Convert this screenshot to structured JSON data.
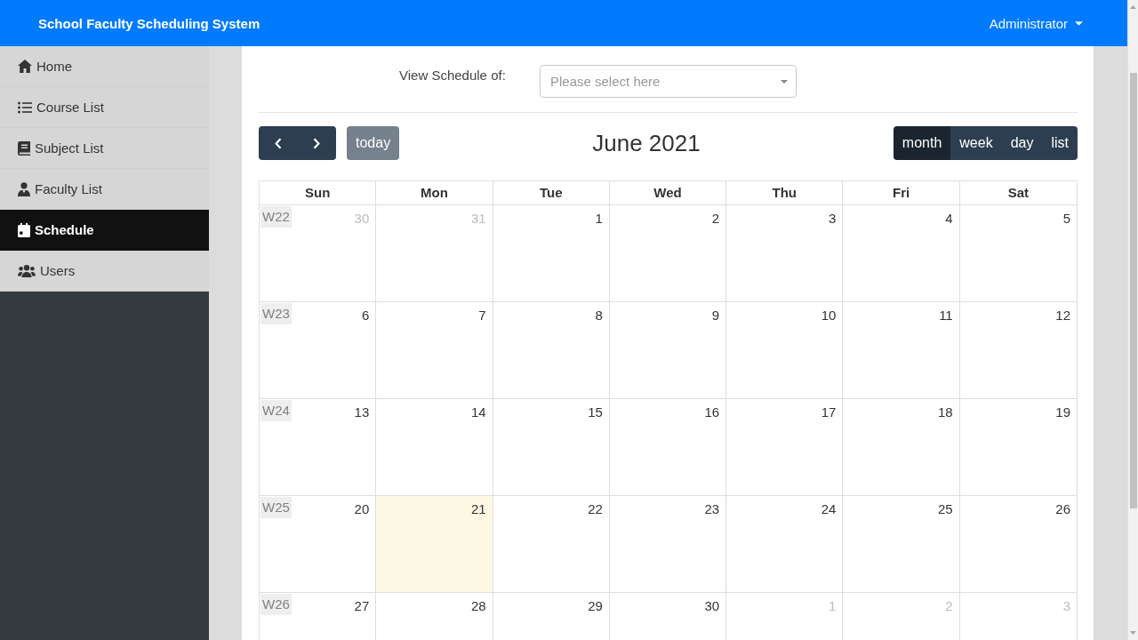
{
  "navbar": {
    "title": "School Faculty Scheduling System",
    "user_menu": "Administrator"
  },
  "sidebar": {
    "items": [
      {
        "label": "Home",
        "selected": false
      },
      {
        "label": "Course List",
        "selected": false
      },
      {
        "label": "Subject List",
        "selected": false
      },
      {
        "label": "Faculty List",
        "selected": false
      },
      {
        "label": "Schedule",
        "selected": true
      },
      {
        "label": "Users",
        "selected": false
      }
    ]
  },
  "schedule_filter": {
    "label": "View Schedule of:",
    "placeholder": "Please select here"
  },
  "calendar": {
    "today_button": {
      "label": "today",
      "disabled": true
    },
    "title": "June 2021",
    "views": [
      {
        "label": "month",
        "selected": true
      },
      {
        "label": "week",
        "selected": false
      },
      {
        "label": "day",
        "selected": false
      },
      {
        "label": "list",
        "selected": false
      }
    ],
    "weekdays": [
      "Sun",
      "Mon",
      "Tue",
      "Wed",
      "Thu",
      "Fri",
      "Sat"
    ],
    "weeks": [
      {
        "week": "W22",
        "days": [
          {
            "day": "30",
            "other_month": true,
            "today": false
          },
          {
            "day": "31",
            "other_month": true,
            "today": false
          },
          {
            "day": "1",
            "other_month": false,
            "today": false
          },
          {
            "day": "2",
            "other_month": false,
            "today": false
          },
          {
            "day": "3",
            "other_month": false,
            "today": false
          },
          {
            "day": "4",
            "other_month": false,
            "today": false
          },
          {
            "day": "5",
            "other_month": false,
            "today": false
          }
        ]
      },
      {
        "week": "W23",
        "days": [
          {
            "day": "6",
            "other_month": false,
            "today": false
          },
          {
            "day": "7",
            "other_month": false,
            "today": false
          },
          {
            "day": "8",
            "other_month": false,
            "today": false
          },
          {
            "day": "9",
            "other_month": false,
            "today": false
          },
          {
            "day": "10",
            "other_month": false,
            "today": false
          },
          {
            "day": "11",
            "other_month": false,
            "today": false
          },
          {
            "day": "12",
            "other_month": false,
            "today": false
          }
        ]
      },
      {
        "week": "W24",
        "days": [
          {
            "day": "13",
            "other_month": false,
            "today": false
          },
          {
            "day": "14",
            "other_month": false,
            "today": false
          },
          {
            "day": "15",
            "other_month": false,
            "today": false
          },
          {
            "day": "16",
            "other_month": false,
            "today": false
          },
          {
            "day": "17",
            "other_month": false,
            "today": false
          },
          {
            "day": "18",
            "other_month": false,
            "today": false
          },
          {
            "day": "19",
            "other_month": false,
            "today": false
          }
        ]
      },
      {
        "week": "W25",
        "days": [
          {
            "day": "20",
            "other_month": false,
            "today": false
          },
          {
            "day": "21",
            "other_month": false,
            "today": true
          },
          {
            "day": "22",
            "other_month": false,
            "today": false
          },
          {
            "day": "23",
            "other_month": false,
            "today": false
          },
          {
            "day": "24",
            "other_month": false,
            "today": false
          },
          {
            "day": "25",
            "other_month": false,
            "today": false
          },
          {
            "day": "26",
            "other_month": false,
            "today": false
          }
        ]
      },
      {
        "week": "W26",
        "days": [
          {
            "day": "27",
            "other_month": false,
            "today": false
          },
          {
            "day": "28",
            "other_month": false,
            "today": false
          },
          {
            "day": "29",
            "other_month": false,
            "today": false
          },
          {
            "day": "30",
            "other_month": false,
            "today": false
          },
          {
            "day": "1",
            "other_month": true,
            "today": false
          },
          {
            "day": "2",
            "other_month": true,
            "today": false
          },
          {
            "day": "3",
            "other_month": true,
            "today": false
          }
        ]
      }
    ]
  }
}
